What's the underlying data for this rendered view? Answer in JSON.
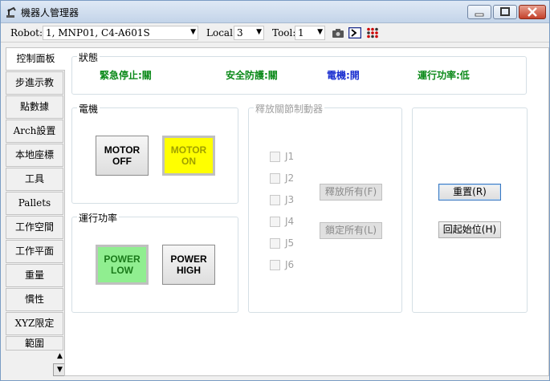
{
  "window": {
    "title": "機器人管理器"
  },
  "toolbar": {
    "robot_label": "Robot:",
    "robot_value": "1, MNP01, C4-A601S",
    "local_label": "Local:",
    "local_value": "3",
    "tool_label": "Tool:",
    "tool_value": "1"
  },
  "sidebar": {
    "tabs": [
      {
        "label": "控制面板"
      },
      {
        "label": "步進示教"
      },
      {
        "label": "點數據"
      },
      {
        "label": "Arch設置"
      },
      {
        "label": "本地座標"
      },
      {
        "label": "工具"
      },
      {
        "label": "Pallets"
      },
      {
        "label": "工作空間"
      },
      {
        "label": "工作平面"
      },
      {
        "label": "重量"
      },
      {
        "label": "慣性"
      },
      {
        "label": "XYZ限定"
      },
      {
        "label": "範圍"
      }
    ]
  },
  "status": {
    "title": "狀態",
    "estop": "緊急停止:關",
    "safeguard": "安全防護:關",
    "motor": "電機:開",
    "power": "運行功率:低"
  },
  "motor": {
    "title": "電機",
    "off_line1": "MOTOR",
    "off_line2": "OFF",
    "on_line1": "MOTOR",
    "on_line2": "ON"
  },
  "power": {
    "title": "運行功率",
    "low_line1": "POWER",
    "low_line2": "LOW",
    "high_line1": "POWER",
    "high_line2": "HIGH"
  },
  "brake": {
    "title": "釋放關節制動器",
    "joints": [
      "J1",
      "J2",
      "J3",
      "J4",
      "J5",
      "J6"
    ],
    "release_all": "釋放所有(F)",
    "lock_all": "鎖定所有(L)"
  },
  "actions": {
    "reset": "重置(R)",
    "home": "回起始位(H)"
  },
  "colors": {
    "status_green": "#0c8a1a",
    "status_blue": "#1a2fd0",
    "motor_on": "#ffff00",
    "power_low": "#90ee90"
  }
}
